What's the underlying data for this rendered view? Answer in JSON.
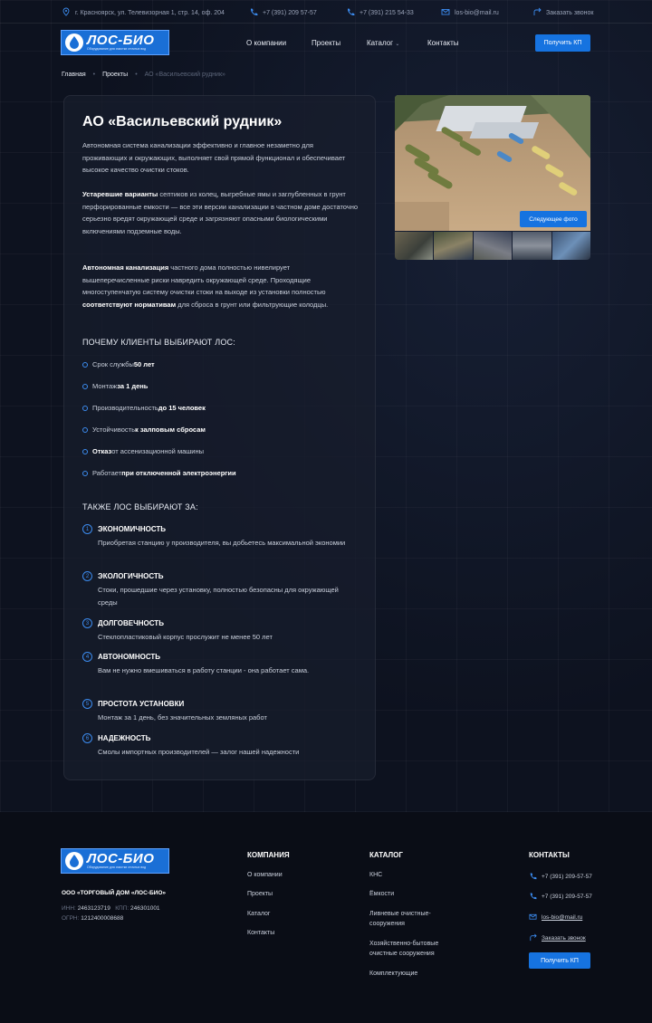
{
  "topbar": {
    "address": "г. Красноярск, ул. Телевизорная 1, стр. 14, оф. 204",
    "phone1": "+7 (391) 209 57-57",
    "phone2": "+7 (391) 215 54-33",
    "email": "los-bio@mail.ru",
    "callback": "Заказать звонок"
  },
  "logo": {
    "name": "ЛОС-БИО",
    "tagline": "Оборудование для очистки сточных вод"
  },
  "nav": {
    "items": [
      "О компании",
      "Проекты",
      "Каталог",
      "Контакты"
    ],
    "cta": "Получить КП"
  },
  "breadcrumb": {
    "home": "Главная",
    "section": "Проекты",
    "current": "АО «Васильевский рудник»"
  },
  "article": {
    "title": "АО «Васильевский рудник»",
    "intro": "Автономная система канализации эффективно и главное незаметно для проживающих и окружающих, выполняет свой прямой функционал и обеспечивает высокое качество очистки стоков.",
    "p2_bold": "Устаревшие варианты",
    "p2_rest": " септиков из колец, выгребные ямы и заглубленных в грунт перфорированные емкости — все эти версии канализации в частном доме достаточно серьезно вредят окружающей среде и загрязняют опасными биологическими включениями подземные воды.",
    "p3_bold1": "Автономная канализация",
    "p3_mid": " частного дома полностью нивелирует вышеперечисленные риски навредить окружающей среде. Проходящие многоступенчатую систему очистки стоки на выходе из установки полностью ",
    "p3_bold2": "соответствуют нормативам",
    "p3_end": " для сброса в грунт или фильтрующие колодцы.",
    "why_title": "ПОЧЕМУ КЛИЕНТЫ ВЫБИРАЮТ ЛОС:",
    "why": [
      {
        "pre": "Срок службы ",
        "bold": "50 лет",
        "post": ""
      },
      {
        "pre": "Монтаж ",
        "bold": "за 1 день",
        "post": ""
      },
      {
        "pre": "Производительность ",
        "bold": "до 15 человек",
        "post": ""
      },
      {
        "pre": "Устойчивость ",
        "bold": "к залповым сбросам",
        "post": ""
      },
      {
        "pre": "",
        "bold": "Отказ",
        "post": " от ассенизационной машины"
      },
      {
        "pre": "Работает ",
        "bold": "при отключенной электроэнергии",
        "post": ""
      }
    ],
    "also_title": "ТАКЖЕ ЛОС ВЫБИРАЮТ ЗА:",
    "features": [
      {
        "num": "1",
        "title": "ЭКОНОМИЧНОСТЬ",
        "desc": "Приобретая станцию у производителя, вы добьетесь максимальной экономии"
      },
      {
        "num": "2",
        "title": "ЭКОЛОГИЧНОСТЬ",
        "desc": "Стоки, прошедшие через установку, полностью безопасны для окружающей среды"
      },
      {
        "num": "3",
        "title": "ДОЛГОВЕЧНОСТЬ",
        "desc": "Стеклопластиковый корпус прослужит не менее 50 лет"
      },
      {
        "num": "4",
        "title": "АВТОНОМНОСТЬ",
        "desc": "Вам не нужно вмешиваться в работу станции - она работает сама."
      },
      {
        "num": "5",
        "title": "ПРОСТОТА УСТАНОВКИ",
        "desc": "Монтаж за 1 день, без значительных земляных работ"
      },
      {
        "num": "6",
        "title": "НАДЕЖНОСТЬ",
        "desc": "Смолы импортных производителей — залог нашей надежности"
      }
    ]
  },
  "gallery": {
    "next_label": "Следующее фото"
  },
  "footer": {
    "company_name": "ООО «ТОРГОВЫЙ ДОМ «ЛОС-БИО»",
    "inn_label": "ИНН:",
    "inn": "2463123719",
    "kpp_label": "КПП:",
    "kpp": "246301001",
    "ogrn_label": "ОГРН:",
    "ogrn": "1212400008688",
    "company_title": "КОМПАНИЯ",
    "company_links": [
      "О компании",
      "Проекты",
      "Каталог",
      "Контакты"
    ],
    "catalog_title": "КАТАЛОГ",
    "catalog_links": [
      "КНС",
      "Ёмкости",
      "Ливневые очистные-сооружения",
      "Хозяйственно-бытовые очистные сооружения",
      "Комплектующие"
    ],
    "contacts_title": "КОНТАКТЫ",
    "phone1": "+7 (391) 209-57-57",
    "phone2": "+7 (391) 209-57-57",
    "email": "los-bio@mail.ru",
    "callback": "Заказать звонок",
    "cta": "Получить КП"
  },
  "colors": {
    "accent": "#1673e0",
    "bg": "#0d121f"
  },
  "icons": [
    "location-icon",
    "phone-icon",
    "mail-icon",
    "callback-icon",
    "chevron-down-icon",
    "water-drop-icon"
  ]
}
